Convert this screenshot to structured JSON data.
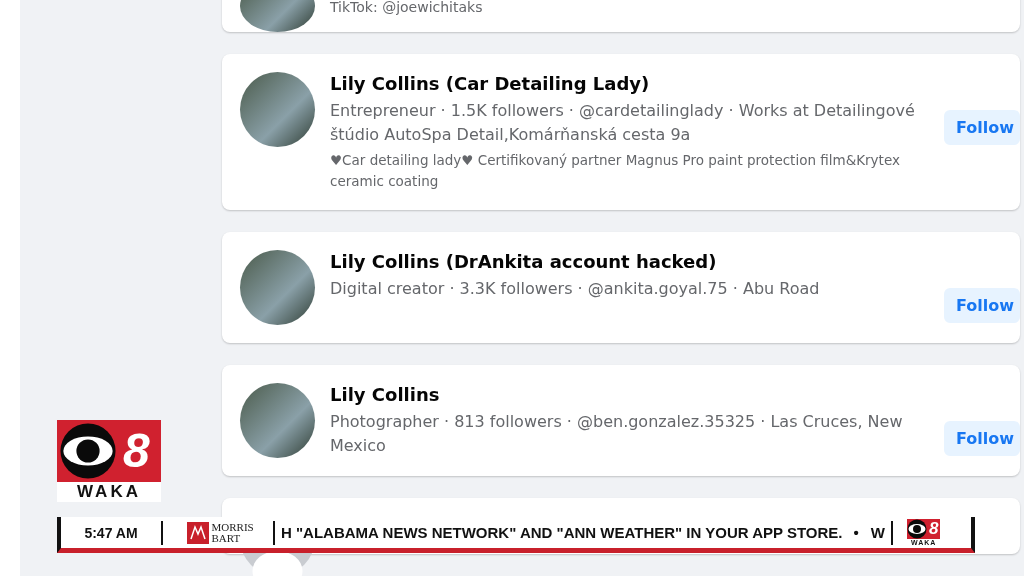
{
  "top_result_fragment": {
    "details": "TikTok: @joewichitaks"
  },
  "results": [
    {
      "kind": "photo",
      "name": "Lily Collins (Car Detailing Lady)",
      "details": "Entrepreneur · 1.5K followers · @cardetailinglady · Works at Detailingové štúdio AutoSpa Detail,Komárňanská cesta 9a",
      "bio": "♥Car detailing lady♥ Certifikovaný partner Magnus Pro paint protection film&Krytex ceramic coating",
      "action": "Follow"
    },
    {
      "kind": "photo",
      "name": "Lily Collins (DrAnkita account hacked)",
      "details": "Digital creator · 3.3K followers · @ankita.goyal.75 · Abu Road",
      "action": "Follow"
    },
    {
      "kind": "photo",
      "name": "Lily Collins",
      "details": "Photographer · 813 followers · @ben.gonzalez.35325 · Las Cruces, New Mexico",
      "action": "Follow"
    },
    {
      "kind": "default"
    }
  ],
  "station_logo": {
    "channel": "8",
    "call_sign": "WAKA"
  },
  "ticker": {
    "time": "5:47 AM",
    "sponsor": "MORRIS BART",
    "headline": "H \"ALABAMA NEWS NETWORK\" AND \"ANN WEATHER\" IN YOUR APP STORE.",
    "separator": "•",
    "next": "W",
    "logo_channel": "8",
    "logo_call_sign": "WAKA"
  }
}
